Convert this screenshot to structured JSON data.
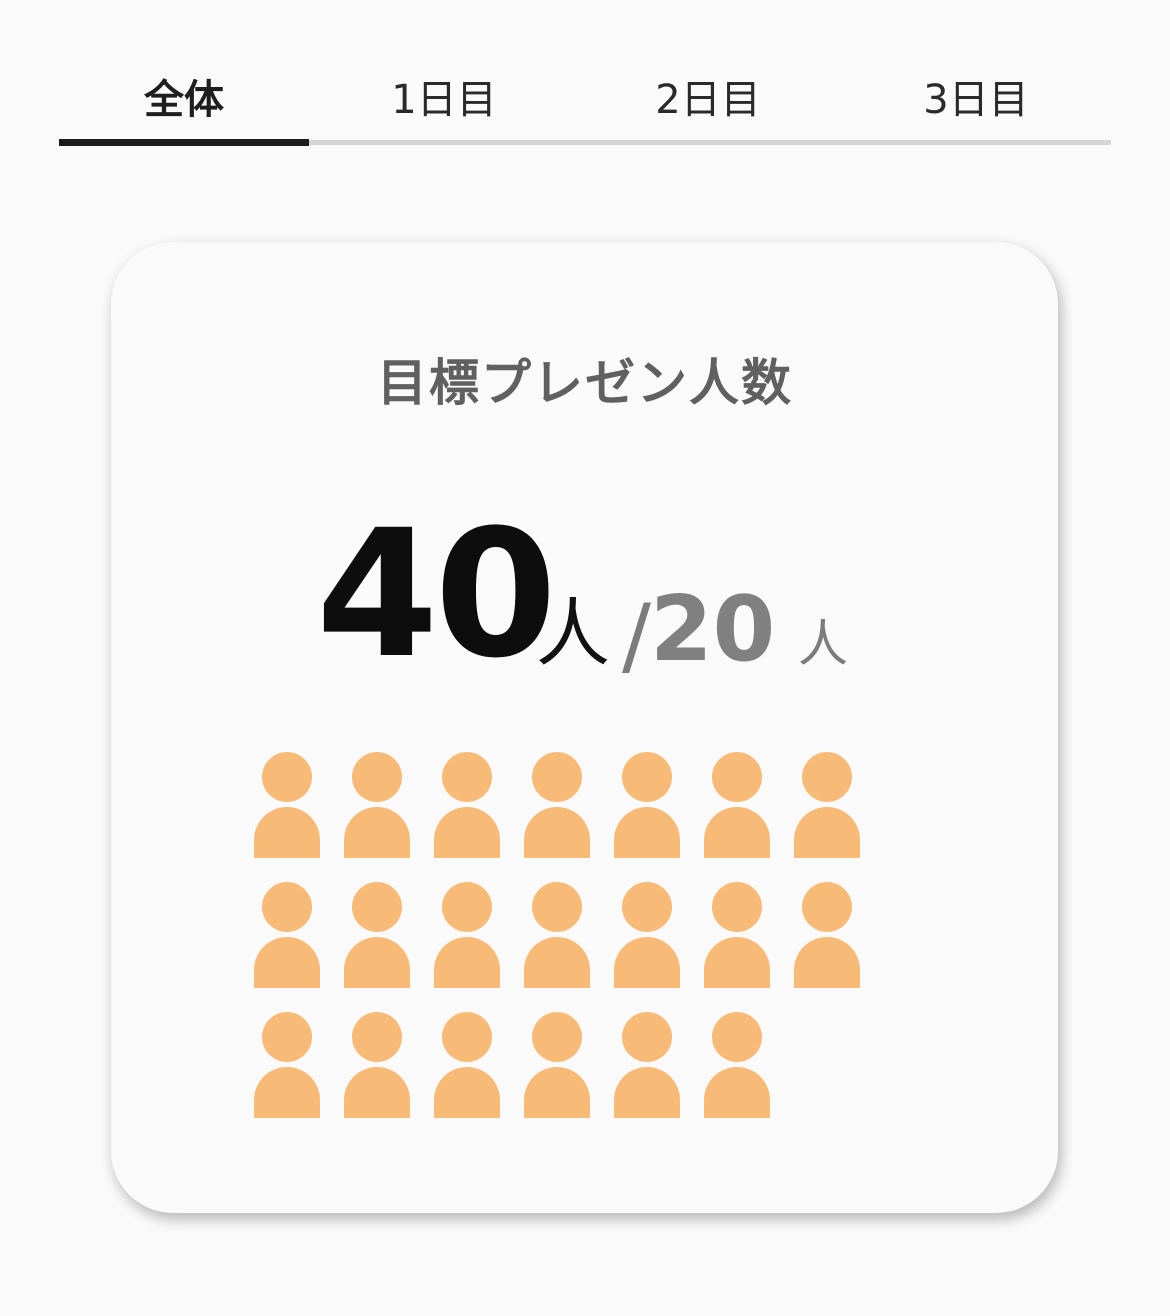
{
  "tabs": [
    {
      "label": "全体",
      "active": true
    },
    {
      "label": "1日目",
      "active": false
    },
    {
      "label": "2日目",
      "active": false
    },
    {
      "label": "3日目",
      "active": false
    }
  ],
  "card": {
    "title": "目標プレゼン人数",
    "current_count": "40",
    "current_unit": "人",
    "separator": "/",
    "target_count": "20",
    "target_unit": "人",
    "person_icon": "person-icon",
    "person_icon_count": 20,
    "person_icon_color": "#f7bb77"
  },
  "colors": {
    "active_tab_indicator": "#1c1c1c",
    "tab_track": "#d5d5d5",
    "background": "#fafafa"
  }
}
